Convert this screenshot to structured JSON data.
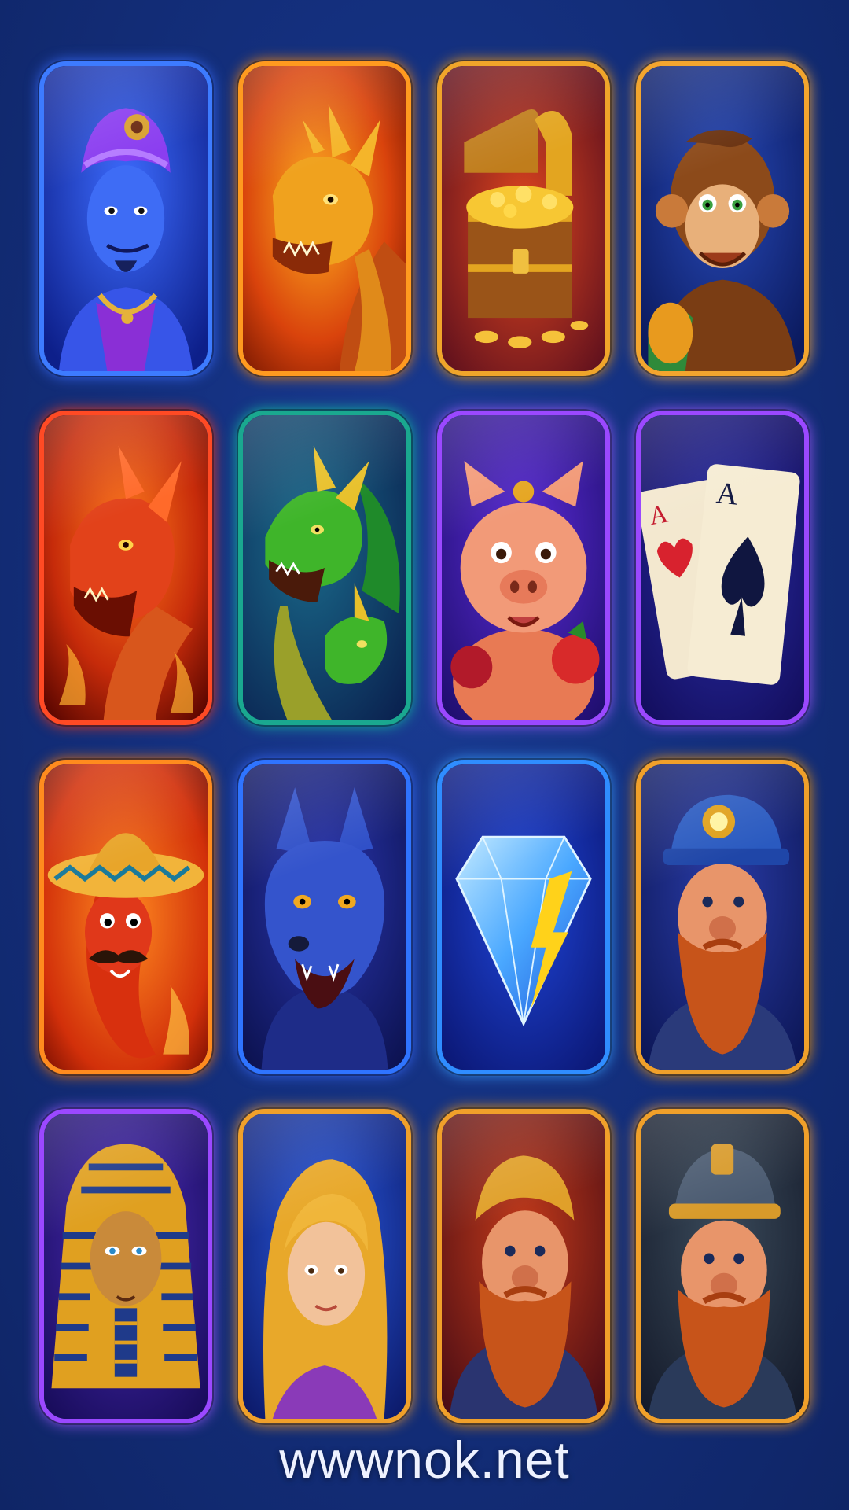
{
  "footer": {
    "domain_text": "wwwnok.net"
  },
  "tiles": [
    {
      "icon": "genie-icon",
      "frame": "#3d7bff",
      "glow": "#3a6dff"
    },
    {
      "icon": "golden-dragon-icon",
      "frame": "#ff9a1f",
      "glow": "#ff8a00"
    },
    {
      "icon": "treasure-chest-icon",
      "frame": "#f0a52a",
      "glow": "#ff9d00"
    },
    {
      "icon": "monkey-icon",
      "frame": "#f3a52e",
      "glow": "#ffae3a"
    },
    {
      "icon": "fire-dragon-icon",
      "frame": "#ff4a24",
      "glow": "#ff3a10"
    },
    {
      "icon": "green-dragon-icon",
      "frame": "#1aa88f",
      "glow": "#14c4a0"
    },
    {
      "icon": "pig-icon",
      "frame": "#9b48ff",
      "glow": "#a35bff"
    },
    {
      "icon": "playing-cards-icon",
      "frame": "#9b48ff",
      "glow": "#a35bff"
    },
    {
      "icon": "chili-pepper-icon",
      "frame": "#ff8b1e",
      "glow": "#ff7a00"
    },
    {
      "icon": "wolf-icon",
      "frame": "#2f74ff",
      "glow": "#3a6dff"
    },
    {
      "icon": "diamond-icon",
      "frame": "#2f8dff",
      "glow": "#3aa0ff"
    },
    {
      "icon": "miner-dwarf-icon",
      "frame": "#f0a02a",
      "glow": "#ff9d00"
    },
    {
      "icon": "pharaoh-icon",
      "frame": "#9b48ff",
      "glow": "#a35bff"
    },
    {
      "icon": "princess-icon",
      "frame": "#f0a02a",
      "glow": "#ffa42a"
    },
    {
      "icon": "dwarf-icon",
      "frame": "#f0a02a",
      "glow": "#ff9d00"
    },
    {
      "icon": "helmet-dwarf-icon",
      "frame": "#f0a02a",
      "glow": "#ffa42a"
    }
  ]
}
